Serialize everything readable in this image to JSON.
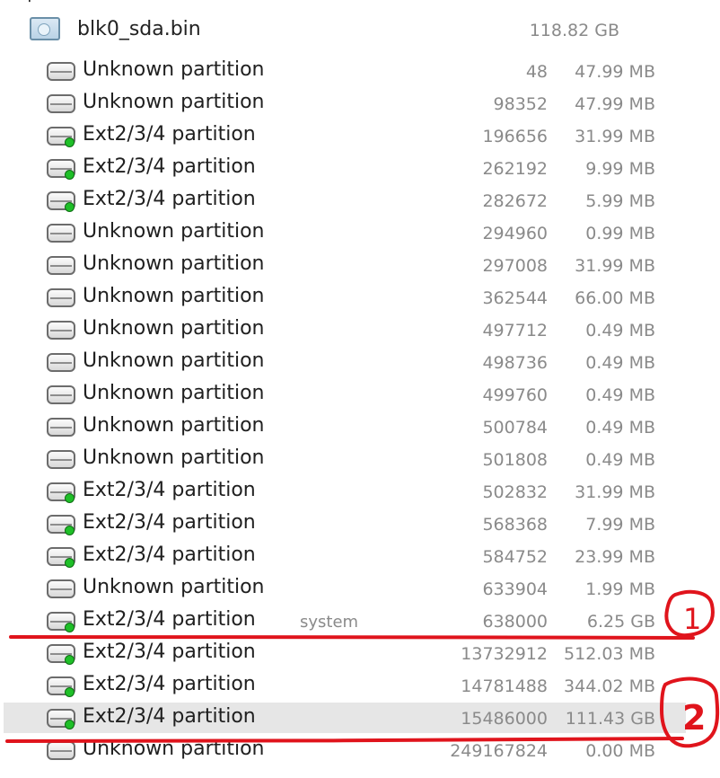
{
  "root": {
    "name": "blk0_sda.bin",
    "size": "118.82 GB",
    "icon": "disk-image-icon"
  },
  "partitions": [
    {
      "name": "Unknown partition",
      "type": "unknown",
      "label": "",
      "offset": "48",
      "size": "47.99 MB"
    },
    {
      "name": "Unknown partition",
      "type": "unknown",
      "label": "",
      "offset": "98352",
      "size": "47.99 MB"
    },
    {
      "name": "Ext2/3/4 partition",
      "type": "ext",
      "label": "",
      "offset": "196656",
      "size": "31.99 MB"
    },
    {
      "name": "Ext2/3/4 partition",
      "type": "ext",
      "label": "",
      "offset": "262192",
      "size": "9.99 MB"
    },
    {
      "name": "Ext2/3/4 partition",
      "type": "ext",
      "label": "",
      "offset": "282672",
      "size": "5.99 MB"
    },
    {
      "name": "Unknown partition",
      "type": "unknown",
      "label": "",
      "offset": "294960",
      "size": "0.99 MB"
    },
    {
      "name": "Unknown partition",
      "type": "unknown",
      "label": "",
      "offset": "297008",
      "size": "31.99 MB"
    },
    {
      "name": "Unknown partition",
      "type": "unknown",
      "label": "",
      "offset": "362544",
      "size": "66.00 MB"
    },
    {
      "name": "Unknown partition",
      "type": "unknown",
      "label": "",
      "offset": "497712",
      "size": "0.49 MB"
    },
    {
      "name": "Unknown partition",
      "type": "unknown",
      "label": "",
      "offset": "498736",
      "size": "0.49 MB"
    },
    {
      "name": "Unknown partition",
      "type": "unknown",
      "label": "",
      "offset": "499760",
      "size": "0.49 MB"
    },
    {
      "name": "Unknown partition",
      "type": "unknown",
      "label": "",
      "offset": "500784",
      "size": "0.49 MB"
    },
    {
      "name": "Unknown partition",
      "type": "unknown",
      "label": "",
      "offset": "501808",
      "size": "0.49 MB"
    },
    {
      "name": "Ext2/3/4 partition",
      "type": "ext",
      "label": "",
      "offset": "502832",
      "size": "31.99 MB"
    },
    {
      "name": "Ext2/3/4 partition",
      "type": "ext",
      "label": "",
      "offset": "568368",
      "size": "7.99 MB"
    },
    {
      "name": "Ext2/3/4 partition",
      "type": "ext",
      "label": "",
      "offset": "584752",
      "size": "23.99 MB"
    },
    {
      "name": "Unknown partition",
      "type": "unknown",
      "label": "",
      "offset": "633904",
      "size": "1.99 MB"
    },
    {
      "name": "Ext2/3/4 partition",
      "type": "ext",
      "label": "system",
      "offset": "638000",
      "size": "6.25 GB"
    },
    {
      "name": "Ext2/3/4 partition",
      "type": "ext",
      "label": "",
      "offset": "13732912",
      "size": "512.03 MB"
    },
    {
      "name": "Ext2/3/4 partition",
      "type": "ext",
      "label": "",
      "offset": "14781488",
      "size": "344.02 MB"
    },
    {
      "name": "Ext2/3/4 partition",
      "type": "ext",
      "label": "",
      "offset": "15486000",
      "size": "111.43 GB",
      "selected": true
    },
    {
      "name": "Unknown partition",
      "type": "unknown",
      "label": "",
      "offset": "249167824",
      "size": "0.00 MB"
    }
  ],
  "annotations": [
    {
      "label": "1",
      "color": "#e0141c"
    },
    {
      "label": "2",
      "color": "#e0141c"
    }
  ],
  "colors": {
    "selection": "#e6e6e6",
    "muted_text": "#8a8a8a",
    "led_green": "#1fbf28",
    "annotation_red": "#e0141c"
  }
}
